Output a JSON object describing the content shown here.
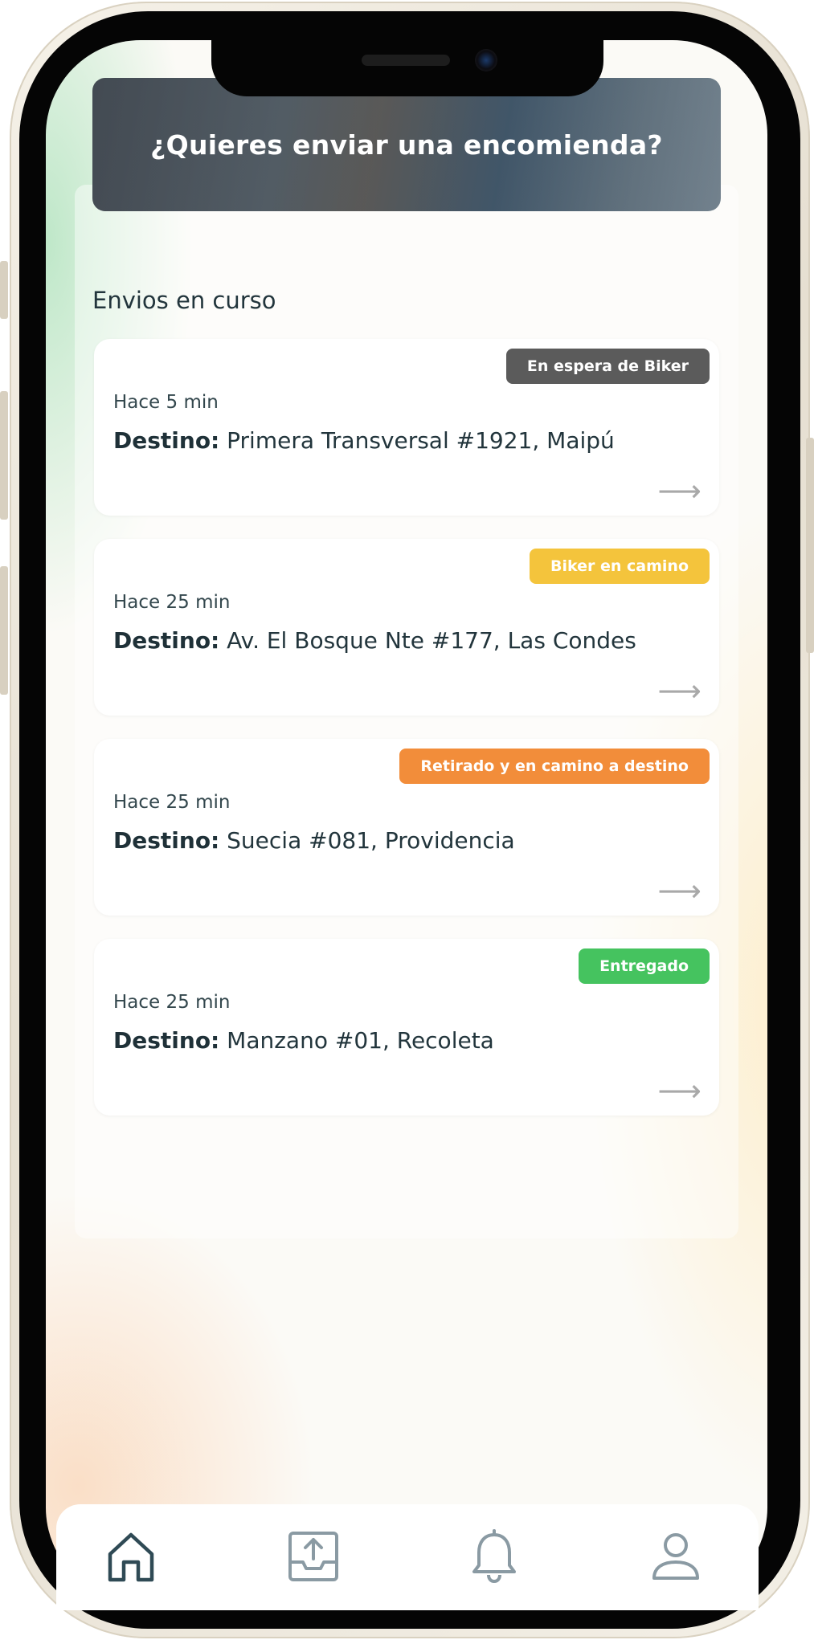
{
  "banner": {
    "title": "¿Quieres enviar una encomienda?"
  },
  "section": {
    "title": "Envios en curso"
  },
  "shipments": [
    {
      "status": "En espera de Biker",
      "status_color": "#5b5b5b",
      "time": "Hace 5 min",
      "destination_label": "Destino:",
      "destination": "Primera Transversal #1921, Maipú"
    },
    {
      "status": "Biker en camino",
      "status_color": "#f4c43c",
      "time": "Hace 25 min",
      "destination_label": "Destino:",
      "destination": "Av. El Bosque Nte #177, Las Condes"
    },
    {
      "status": "Retirado y en camino a destino",
      "status_color": "#f28d3a",
      "time": "Hace 25 min",
      "destination_label": "Destino:",
      "destination": "Suecia #081, Providencia"
    },
    {
      "status": "Entregado",
      "status_color": "#45c35f",
      "time": "Hace 25 min",
      "destination_label": "Destino:",
      "destination": "Manzano #01, Recoleta"
    }
  ],
  "nav": {
    "items": [
      {
        "icon": "home-icon",
        "active": true
      },
      {
        "icon": "upload-tray-icon",
        "active": false
      },
      {
        "icon": "bell-icon",
        "active": false
      },
      {
        "icon": "user-icon",
        "active": false
      }
    ],
    "active_color": "#2f4a55",
    "inactive_color": "#8a9aa3"
  },
  "arrow_glyph": "⟶"
}
